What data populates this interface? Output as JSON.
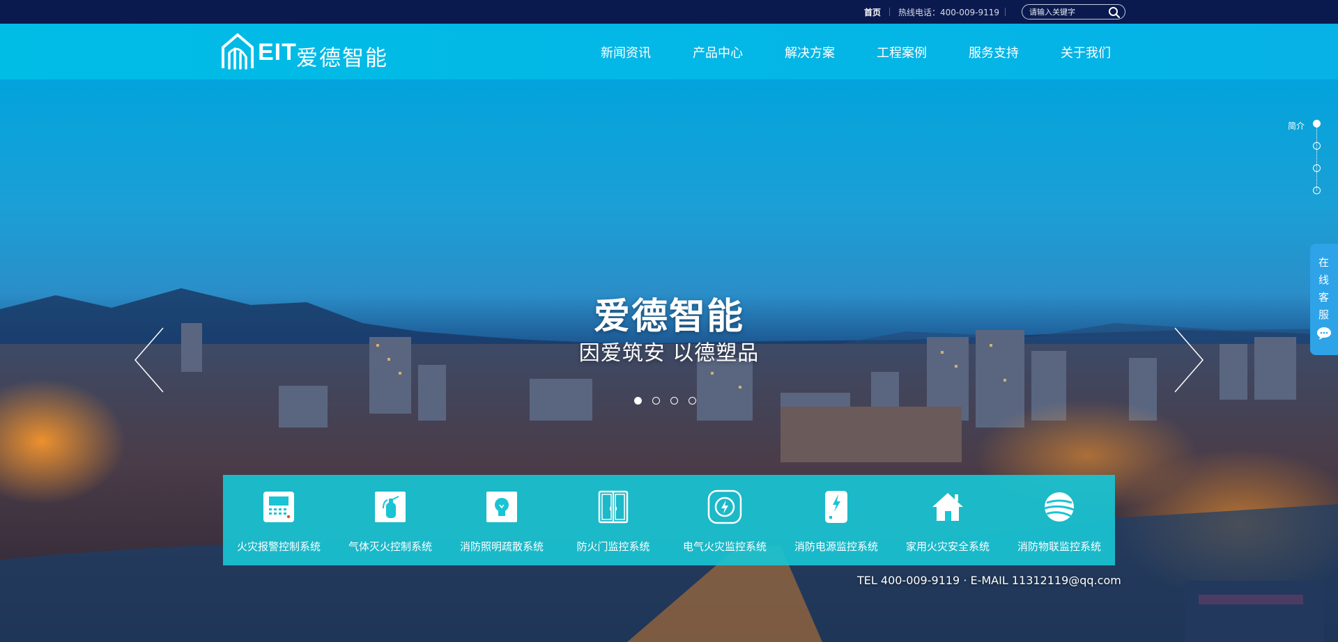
{
  "topbar": {
    "home": "首页",
    "hotline": "热线电话：400-009-9119",
    "search_placeholder": "请输入关键字"
  },
  "header": {
    "brand": "EIT",
    "brand_cn": "爱德智能",
    "nav": [
      "新闻资讯",
      "产品中心",
      "解决方案",
      "工程案例",
      "服务支持",
      "关于我们"
    ]
  },
  "hero": {
    "title": "爱德智能",
    "subtitle": "因爱筑安 以德塑品",
    "slide_count": 4,
    "active_slide": 1
  },
  "sidenav": {
    "label": "简介",
    "sections": 4,
    "active": 1
  },
  "service": {
    "chars": [
      "在",
      "线",
      "客",
      "服"
    ]
  },
  "products": [
    {
      "label": "火灾报警控制系统",
      "icon": "fire-alarm-panel-icon"
    },
    {
      "label": "气体灭火控制系统",
      "icon": "fire-extinguisher-icon"
    },
    {
      "label": "消防照明疏散系统",
      "icon": "light-bulb-icon"
    },
    {
      "label": "防火门监控系统",
      "icon": "fire-door-icon"
    },
    {
      "label": "电气火灾监控系统",
      "icon": "electric-bolt-circle-icon"
    },
    {
      "label": "消防电源监控系统",
      "icon": "power-supply-icon"
    },
    {
      "label": "家用火灾安全系统",
      "icon": "home-icon"
    },
    {
      "label": "消防物联监控系统",
      "icon": "iot-globe-icon"
    }
  ],
  "contact": {
    "text": "TEL 400-009-9119  ·  E-MAIL 11312119@qq.com"
  },
  "colors": {
    "topbar": "#0b1a4e",
    "header": "#00bde6",
    "products_bar": "#19c4d4",
    "service": "#2ea3e8"
  }
}
